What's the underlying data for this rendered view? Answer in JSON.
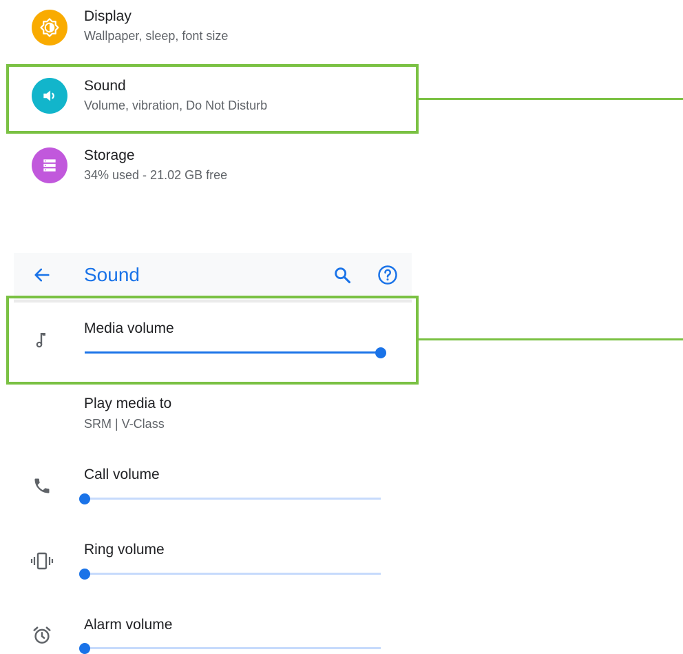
{
  "colors": {
    "accent": "#1a73e8",
    "highlight": "#7ac143",
    "display_icon_bg": "#f9ab00",
    "sound_icon_bg": "#12b5cb",
    "storage_icon_bg": "#c158dc"
  },
  "settings_list": {
    "items": [
      {
        "title": "Display",
        "subtitle": "Wallpaper, sleep, font size",
        "icon": "display-brightness-icon"
      },
      {
        "title": "Sound",
        "subtitle": "Volume, vibration, Do Not Disturb",
        "icon": "speaker-icon"
      },
      {
        "title": "Storage",
        "subtitle": "34% used - 21.02 GB free",
        "icon": "storage-icon"
      }
    ]
  },
  "sound_screen": {
    "title": "Sound",
    "back_icon": "back-arrow-icon",
    "search_icon": "search-icon",
    "help_icon": "help-icon",
    "media_volume": {
      "label": "Media volume",
      "level": 1.0,
      "icon": "music-note-icon"
    },
    "play_media": {
      "label": "Play media to",
      "value": "SRM | V-Class"
    },
    "call_volume": {
      "label": "Call volume",
      "level": 0.0,
      "icon": "phone-icon"
    },
    "ring_volume": {
      "label": "Ring volume",
      "level": 0.0,
      "icon": "vibrate-icon"
    },
    "alarm_volume": {
      "label": "Alarm volume",
      "level": 0.0,
      "icon": "alarm-icon"
    }
  }
}
